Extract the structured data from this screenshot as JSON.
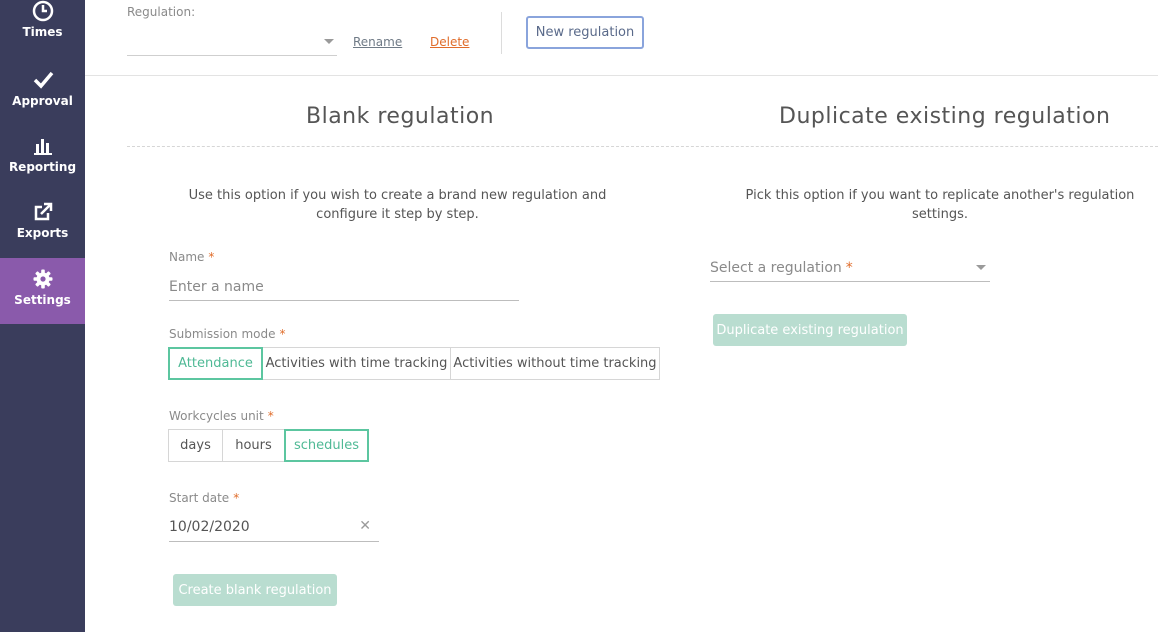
{
  "sidebar": {
    "items": [
      {
        "label": "Times",
        "icon": "clock-icon"
      },
      {
        "label": "Approval",
        "icon": "checkmark-icon"
      },
      {
        "label": "Reporting",
        "icon": "bar-chart-icon"
      },
      {
        "label": "Exports",
        "icon": "export-icon"
      },
      {
        "label": "Settings",
        "icon": "gear-icon",
        "active": true
      }
    ]
  },
  "topbar": {
    "regulation_label": "Regulation:",
    "regulation_value": "",
    "rename_label": "Rename",
    "delete_label": "Delete",
    "new_regulation_label": "New regulation"
  },
  "blank": {
    "heading": "Blank regulation",
    "description": "Use this option if you wish to create a brand new regulation and configure it step by step.",
    "name_label": "Name",
    "name_placeholder": "Enter a name",
    "submission_label": "Submission mode",
    "submission_options": [
      "Attendance",
      "Activities with time tracking",
      "Activities without time tracking"
    ],
    "submission_selected": "Attendance",
    "workcycles_label": "Workcycles unit",
    "workcycles_options": [
      "days",
      "hours",
      "schedules"
    ],
    "workcycles_selected": "schedules",
    "start_date_label": "Start date",
    "start_date_value": "10/02/2020",
    "create_button": "Create blank regulation"
  },
  "duplicate": {
    "heading": "Duplicate existing regulation",
    "description": "Pick this option if you want to replicate another's regulation settings.",
    "select_placeholder": "Select a regulation",
    "button": "Duplicate existing regulation"
  },
  "required_mark": "*",
  "colors": {
    "sidebar_bg": "#3a3d5c",
    "sidebar_active": "#8a5aab",
    "accent_green": "#5cc6a0",
    "disabled_button": "#b9ddd0",
    "delete_orange": "#e06c2a",
    "new_button_border": "#8aa4dc"
  }
}
